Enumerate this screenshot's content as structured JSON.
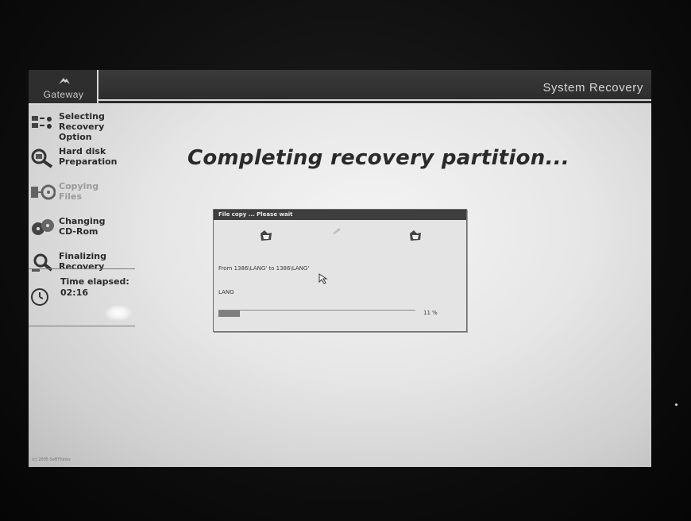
{
  "header": {
    "logo_text": "Gateway",
    "app_title": "System Recovery"
  },
  "sidebar": {
    "steps": [
      {
        "label": "Selecting\nRecovery Option",
        "icon": "selection-icon",
        "state": "done"
      },
      {
        "label": "Hard disk\nPreparation",
        "icon": "magnifier-disk-icon",
        "state": "done"
      },
      {
        "label": "Copying\nFiles",
        "icon": "disk-copy-icon",
        "state": "current"
      },
      {
        "label": "Changing\nCD-Rom",
        "icon": "cd-change-icon",
        "state": "pending"
      },
      {
        "label": "Finalizing\nRecovery",
        "icon": "magnifier-check-icon",
        "state": "pending"
      }
    ],
    "timer": {
      "label": "Time elapsed:",
      "value": "02:16",
      "icon": "clock-icon"
    }
  },
  "main": {
    "heading": "Completing recovery partition..."
  },
  "dialog": {
    "title": "File copy ... Please wait",
    "from_text": "From 1386\\LANG' to 1386\\LANG'",
    "current_file": "LANG",
    "progress_label": "11 %",
    "progress_fraction": 0.11,
    "icons": [
      "folder-source-icon",
      "flying-paper-icon",
      "folder-destination-icon"
    ]
  },
  "footer": {
    "copyright": "(c) 2005 SoftThinks"
  },
  "colors": {
    "screen_bg": "#e6e6e6",
    "header_bg": "#2e2e2e",
    "text_dark": "#2a2a2a",
    "text_dim": "#9a9a9a",
    "progress_fill": "#7f7f7f"
  }
}
